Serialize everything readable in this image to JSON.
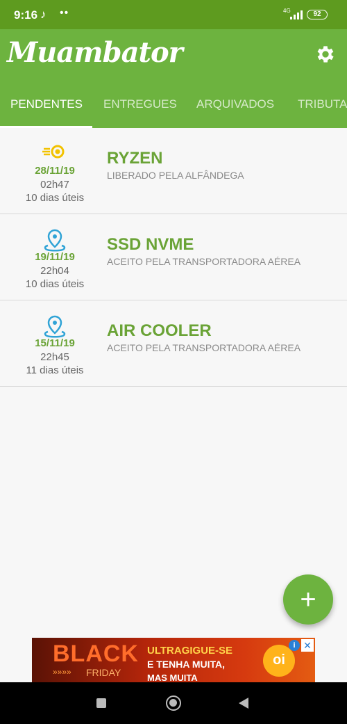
{
  "status_bar": {
    "time": "9:16",
    "notification_icon": "music-note-icon",
    "dots": "••",
    "network": "4G",
    "battery": "92"
  },
  "app_bar": {
    "logo": "Muambator",
    "settings_icon": "gear-icon"
  },
  "tabs": [
    {
      "label": "PENDENTES",
      "active": true
    },
    {
      "label": "ENTREGUES",
      "active": false
    },
    {
      "label": "ARQUIVADOS",
      "active": false
    },
    {
      "label": "TRIBUTADOS",
      "active": false
    }
  ],
  "packages": [
    {
      "icon": "customs-release-icon",
      "date": "28/11/19",
      "time": "02h47",
      "days": "10 dias úteis",
      "title": "RYZEN",
      "status": "LIBERADO PELA ALFÂNDEGA"
    },
    {
      "icon": "map-pin-icon",
      "date": "19/11/19",
      "time": "22h04",
      "days": "10 dias úteis",
      "title": "SSD NVME",
      "status": "ACEITO PELA TRANSPORTADORA AÉREA"
    },
    {
      "icon": "map-pin-icon",
      "date": "15/11/19",
      "time": "22h45",
      "days": "11 dias úteis",
      "title": "AIR COOLER",
      "status": "ACEITO PELA TRANSPORTADORA AÉREA"
    }
  ],
  "fab": {
    "label": "+"
  },
  "ad": {
    "black": "BLACK",
    "arrows": "»»»»",
    "friday": "FRIDAY",
    "line1": "ULTRAGIGUE-SE",
    "line2": "E TENHA MUITA,",
    "line3": "MAS MUITA",
    "brand": "oi",
    "info": "i",
    "close": "✕"
  },
  "colors": {
    "primary": "#6db33f",
    "status_bar": "#5e9b1f",
    "accent_text": "#6aa336",
    "pin_blue": "#2fa3d6",
    "customs_yellow": "#f2c200"
  }
}
